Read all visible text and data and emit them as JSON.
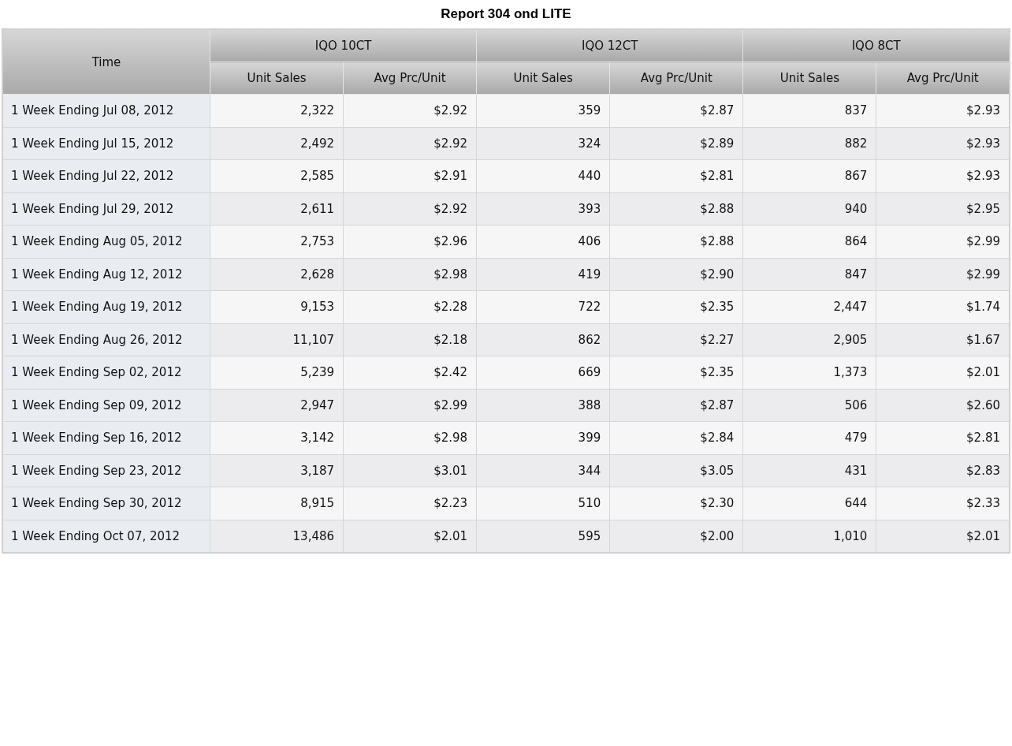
{
  "title": "Report 304 ond LITE",
  "table": {
    "time_heading": "Time",
    "groups": [
      {
        "label": "IQO 10CT",
        "columns": [
          "Unit Sales",
          "Avg Prc/Unit"
        ]
      },
      {
        "label": "IQO 12CT",
        "columns": [
          "Unit Sales",
          "Avg Prc/Unit"
        ]
      },
      {
        "label": "IQO 8CT",
        "columns": [
          "Unit Sales",
          "Avg Prc/Unit"
        ]
      }
    ],
    "rows": [
      {
        "time": "1 Week Ending Jul 08, 2012",
        "cells": [
          "2,322",
          "$2.92",
          "359",
          "$2.87",
          "837",
          "$2.93"
        ]
      },
      {
        "time": "1 Week Ending Jul 15, 2012",
        "cells": [
          "2,492",
          "$2.92",
          "324",
          "$2.89",
          "882",
          "$2.93"
        ]
      },
      {
        "time": "1 Week Ending Jul 22, 2012",
        "cells": [
          "2,585",
          "$2.91",
          "440",
          "$2.81",
          "867",
          "$2.93"
        ]
      },
      {
        "time": "1 Week Ending Jul 29, 2012",
        "cells": [
          "2,611",
          "$2.92",
          "393",
          "$2.88",
          "940",
          "$2.95"
        ]
      },
      {
        "time": "1 Week Ending Aug 05, 2012",
        "cells": [
          "2,753",
          "$2.96",
          "406",
          "$2.88",
          "864",
          "$2.99"
        ]
      },
      {
        "time": "1 Week Ending Aug 12, 2012",
        "cells": [
          "2,628",
          "$2.98",
          "419",
          "$2.90",
          "847",
          "$2.99"
        ]
      },
      {
        "time": "1 Week Ending Aug 19, 2012",
        "cells": [
          "9,153",
          "$2.28",
          "722",
          "$2.35",
          "2,447",
          "$1.74"
        ]
      },
      {
        "time": "1 Week Ending Aug 26, 2012",
        "cells": [
          "11,107",
          "$2.18",
          "862",
          "$2.27",
          "2,905",
          "$1.67"
        ]
      },
      {
        "time": "1 Week Ending Sep 02, 2012",
        "cells": [
          "5,239",
          "$2.42",
          "669",
          "$2.35",
          "1,373",
          "$2.01"
        ]
      },
      {
        "time": "1 Week Ending Sep 09, 2012",
        "cells": [
          "2,947",
          "$2.99",
          "388",
          "$2.87",
          "506",
          "$2.60"
        ]
      },
      {
        "time": "1 Week Ending Sep 16, 2012",
        "cells": [
          "3,142",
          "$2.98",
          "399",
          "$2.84",
          "479",
          "$2.81"
        ]
      },
      {
        "time": "1 Week Ending Sep 23, 2012",
        "cells": [
          "3,187",
          "$3.01",
          "344",
          "$3.05",
          "431",
          "$2.83"
        ]
      },
      {
        "time": "1 Week Ending Sep 30, 2012",
        "cells": [
          "8,915",
          "$2.23",
          "510",
          "$2.30",
          "644",
          "$2.33"
        ]
      },
      {
        "time": "1 Week Ending Oct 07, 2012",
        "cells": [
          "13,486",
          "$2.01",
          "595",
          "$2.00",
          "1,010",
          "$2.01"
        ]
      }
    ]
  }
}
